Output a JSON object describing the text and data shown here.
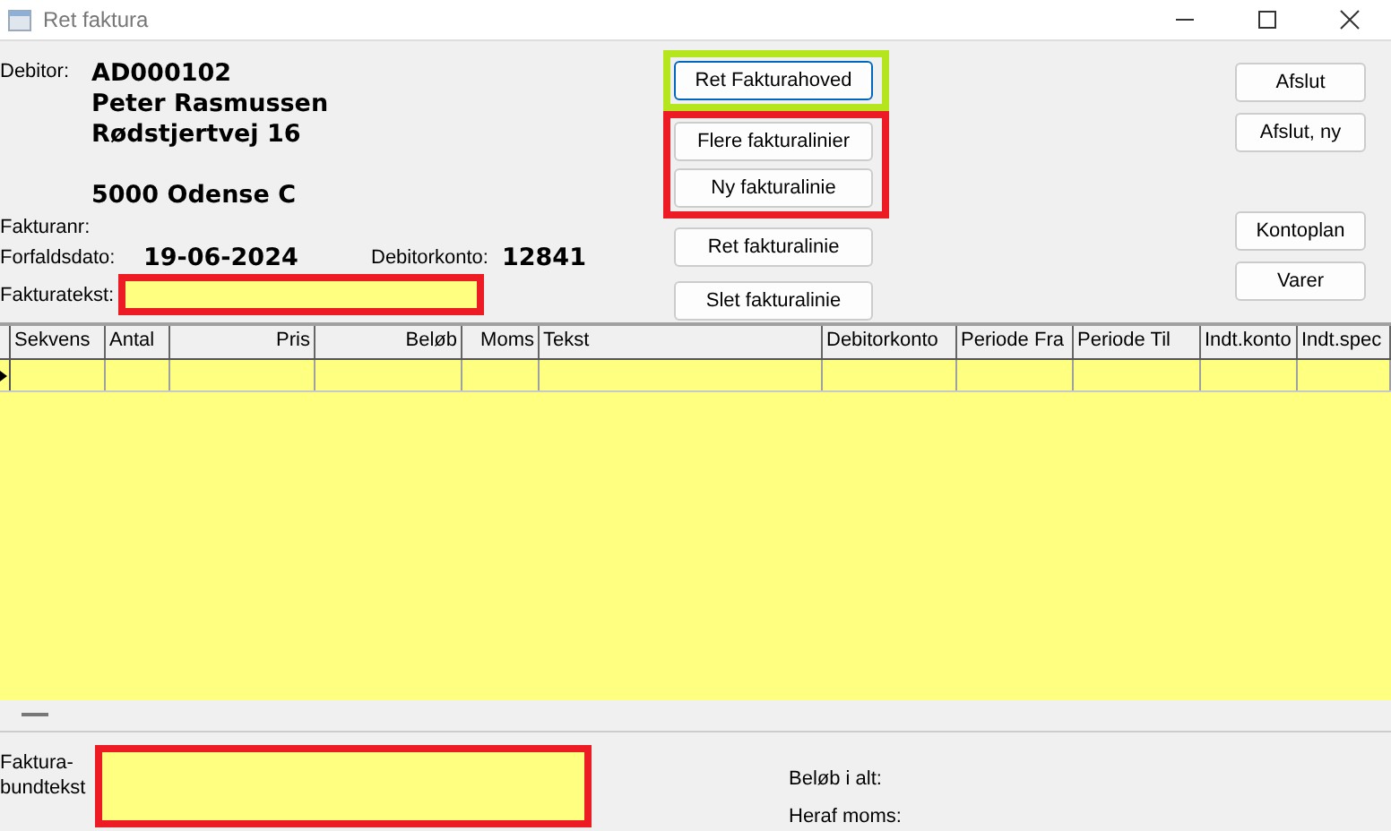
{
  "window": {
    "title": "Ret faktura"
  },
  "debtor": {
    "label": "Debitor:",
    "number": "AD000102",
    "name": "Peter Rasmussen",
    "address": "Rødstjertvej 16",
    "city": "5000 Odense C"
  },
  "invoice_no": {
    "label": "Fakturanr:"
  },
  "due_date": {
    "label": "Forfaldsdato:",
    "value": "19-06-2024"
  },
  "debtor_account": {
    "label": "Debitorkonto:",
    "value": "12841"
  },
  "invoice_text": {
    "label": "Fakturatekst:",
    "color": "#ed1c24"
  },
  "left_buttons": [
    {
      "color": "#b5e61d",
      "buttons": [
        {
          "label": "Ret Fakturahoved",
          "focused": true
        }
      ]
    },
    {
      "color": "#ed1c24",
      "buttons": [
        {
          "label": "Flere fakturalinier",
          "focused": false
        },
        {
          "label": "Ny fakturalinie",
          "focused": false
        }
      ]
    },
    {
      "buttons": [
        {
          "label": "Ret fakturalinie",
          "focused": false
        },
        {
          "label": "Slet fakturalinie",
          "focused": false
        }
      ]
    }
  ],
  "right_buttons": [
    {
      "label": "Afslut"
    },
    {
      "label": "Afslut, ny"
    },
    {
      "label": "Kontoplan"
    },
    {
      "label": "Varer"
    }
  ],
  "table": {
    "columns": [
      {
        "label": "Sekvens",
        "right_aligned": false
      },
      {
        "label": "Antal",
        "right_aligned": false
      },
      {
        "label": "Pris",
        "right_aligned": true
      },
      {
        "label": "Beløb",
        "right_aligned": true
      },
      {
        "label": "Moms",
        "right_aligned": true
      },
      {
        "label": "Tekst",
        "right_aligned": false
      },
      {
        "label": "Debitorkonto",
        "right_aligned": false
      },
      {
        "label": "Periode Fra",
        "right_aligned": false
      },
      {
        "label": "Periode Til",
        "right_aligned": false
      },
      {
        "label": "Indt.konto",
        "right_aligned": false
      },
      {
        "label": "Indt.spec",
        "right_aligned": false
      }
    ],
    "rows": [
      {
        "current": true
      }
    ]
  },
  "footer": {
    "label": "Faktura-\nbundtekst",
    "color": "#ed1c24",
    "total_label": "Beløb i alt:",
    "vat_label": "Heraf moms:"
  }
}
